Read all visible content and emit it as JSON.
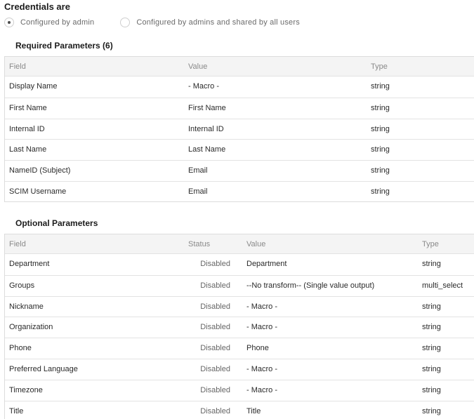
{
  "credentials": {
    "title": "Credentials are",
    "options": [
      {
        "label": "Configured by admin",
        "checked": true
      },
      {
        "label": "Configured by admins and shared by all users",
        "checked": false
      }
    ]
  },
  "required": {
    "title": "Required Parameters (6)",
    "headers": {
      "field": "Field",
      "value": "Value",
      "type": "Type"
    },
    "rows": [
      {
        "field": "Display Name",
        "value": "- Macro -",
        "type": "string"
      },
      {
        "field": "First Name",
        "value": "First Name",
        "type": "string"
      },
      {
        "field": "Internal ID",
        "value": "Internal ID",
        "type": "string"
      },
      {
        "field": "Last Name",
        "value": "Last Name",
        "type": "string"
      },
      {
        "field": "NameID (Subject)",
        "value": "Email",
        "type": "string"
      },
      {
        "field": "SCIM Username",
        "value": "Email",
        "type": "string"
      }
    ]
  },
  "optional": {
    "title": "Optional Parameters",
    "headers": {
      "field": "Field",
      "status": "Status",
      "value": "Value",
      "type": "Type"
    },
    "rows": [
      {
        "field": "Department",
        "status": "Disabled",
        "value": "Department",
        "type": "string"
      },
      {
        "field": "Groups",
        "status": "Disabled",
        "value": "--No transform-- (Single value output)",
        "type": "multi_select"
      },
      {
        "field": "Nickname",
        "status": "Disabled",
        "value": "- Macro -",
        "type": "string"
      },
      {
        "field": "Organization",
        "status": "Disabled",
        "value": "- Macro -",
        "type": "string"
      },
      {
        "field": "Phone",
        "status": "Disabled",
        "value": "Phone",
        "type": "string"
      },
      {
        "field": "Preferred Language",
        "status": "Disabled",
        "value": "- Macro -",
        "type": "string"
      },
      {
        "field": "Timezone",
        "status": "Disabled",
        "value": "- Macro -",
        "type": "string"
      },
      {
        "field": "Title",
        "status": "Disabled",
        "value": "Title",
        "type": "string"
      }
    ]
  }
}
